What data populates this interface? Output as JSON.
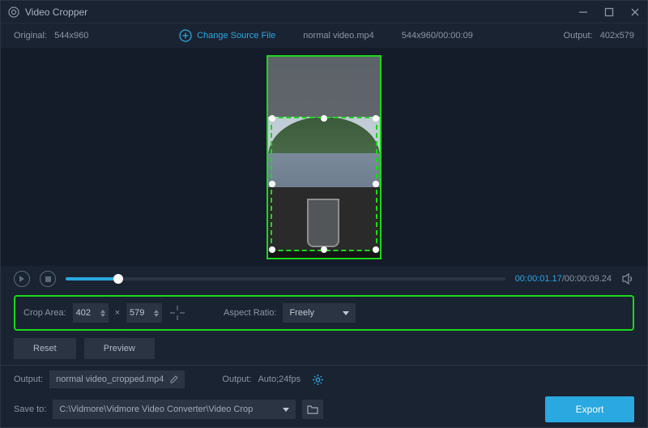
{
  "titlebar": {
    "title": "Video Cropper"
  },
  "infobar": {
    "original_label": "Original:",
    "original_value": "544x960",
    "change_source": "Change Source File",
    "filename": "normal video.mp4",
    "source_spec": "544x960/00:00:09",
    "output_label": "Output:",
    "output_value": "402x579"
  },
  "playbar": {
    "current_time": "00:00:01.17",
    "total_time": "00:00:09.24"
  },
  "crop": {
    "area_label": "Crop Area:",
    "width": "402",
    "height": "579",
    "aspect_label": "Aspect Ratio:",
    "aspect_value": "Freely"
  },
  "actions": {
    "reset": "Reset",
    "preview": "Preview"
  },
  "output": {
    "label1": "Output:",
    "filename": "normal video_cropped.mp4",
    "label2": "Output:",
    "format": "Auto;24fps"
  },
  "save": {
    "label": "Save to:",
    "path": "C:\\Vidmore\\Vidmore Video Converter\\Video Crop",
    "export": "Export"
  }
}
